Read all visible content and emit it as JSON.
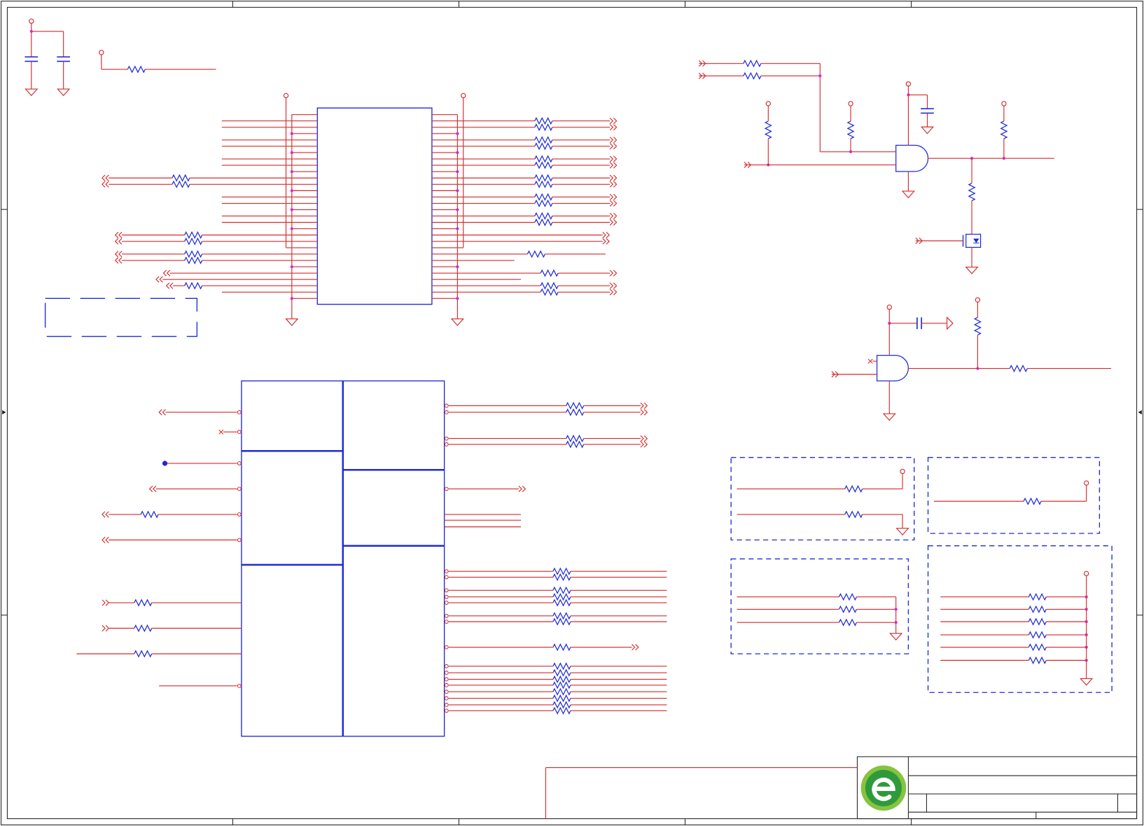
{
  "colors": {
    "wire": "#d62b2b",
    "component": "#1f2bd6",
    "junction": "#e21fcf",
    "frame": "#222222",
    "logo_green": "#2f9a3c",
    "logo_light": "#86c440"
  },
  "icons": {
    "logo": "company-logo-icon",
    "offpage_connector": "offpage-arrow-icon",
    "ground": "ground-symbol",
    "power_pin": "power-pin"
  }
}
